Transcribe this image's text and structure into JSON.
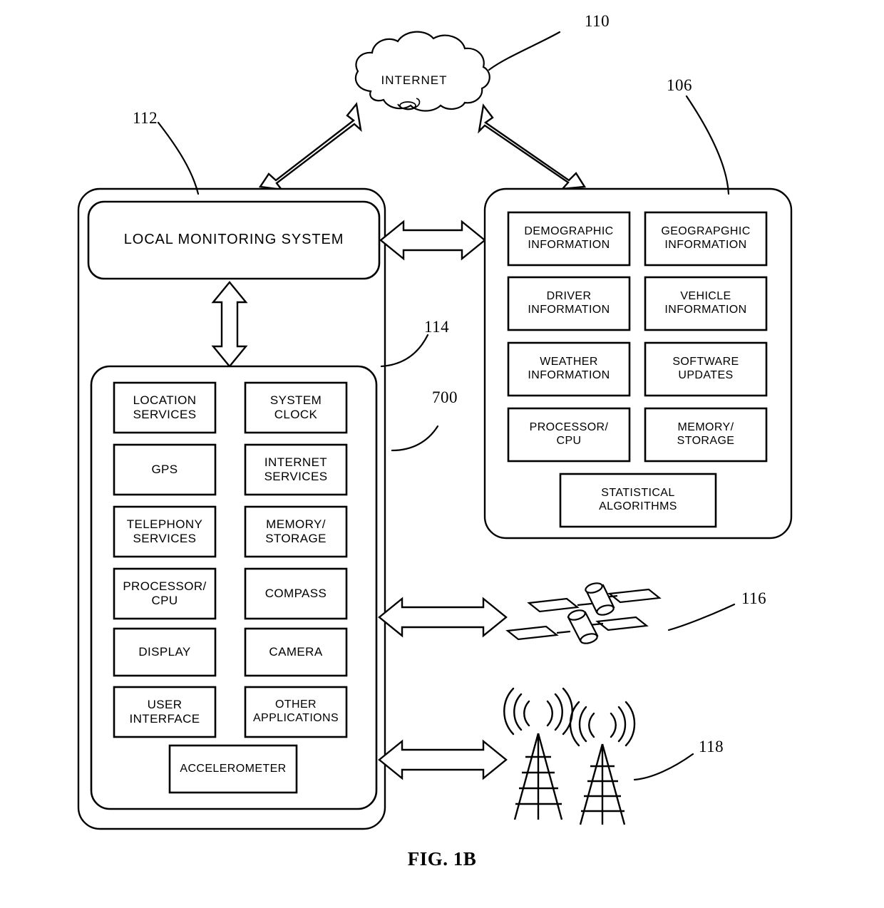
{
  "figure": {
    "caption": "FIG. 1B",
    "cloud_label": "INTERNET"
  },
  "reference_numerals": {
    "internet": "110",
    "mobile_device": "112",
    "remote_server": "106",
    "device_components": "114",
    "device_outer": "700",
    "satellites": "116",
    "cell_towers": "118"
  },
  "mobile_device": {
    "monitoring_system_label": "LOCAL MONITORING SYSTEM",
    "components": [
      {
        "label": "LOCATION\nSERVICES"
      },
      {
        "label": "SYSTEM\nCLOCK"
      },
      {
        "label": "GPS"
      },
      {
        "label": "INTERNET\nSERVICES"
      },
      {
        "label": "TELEPHONY\nSERVICES"
      },
      {
        "label": "MEMORY/\nSTORAGE"
      },
      {
        "label": "PROCESSOR/\nCPU"
      },
      {
        "label": "COMPASS"
      },
      {
        "label": "DISPLAY"
      },
      {
        "label": "CAMERA"
      },
      {
        "label": "USER\nINTERFACE"
      },
      {
        "label": "OTHER\nAPPLICATIONS"
      }
    ],
    "accelerometer_label": "ACCELEROMETER"
  },
  "remote_server": {
    "components": [
      {
        "label": "DEMOGRAPHIC\nINFORMATION"
      },
      {
        "label": "GEOGRAPGHIC\nINFORMATION"
      },
      {
        "label": "DRIVER\nINFORMATION"
      },
      {
        "label": "VEHICLE\nINFORMATION"
      },
      {
        "label": "WEATHER\nINFORMATION"
      },
      {
        "label": "SOFTWARE\nUPDATES"
      },
      {
        "label": "PROCESSOR/\nCPU"
      },
      {
        "label": "MEMORY/\nSTORAGE"
      }
    ],
    "statistical_label": "STATISTICAL\nALGORITHMS"
  },
  "external_nodes": {
    "satellite_count": 2,
    "tower_count": 2
  },
  "style": {
    "ink": "#000000",
    "paper": "#ffffff"
  }
}
